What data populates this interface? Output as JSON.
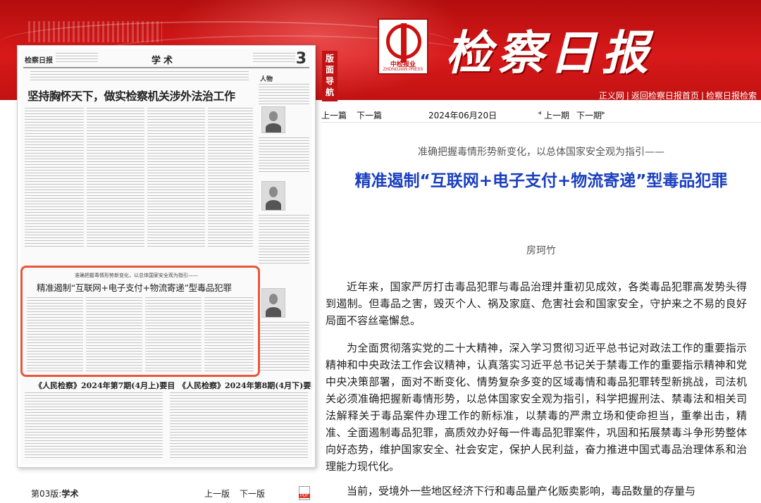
{
  "masthead": {
    "logo_name": "中检报业",
    "logo_sub": "ZHONGJIAN PRESS",
    "paper_name": "检察日报",
    "links": [
      "正义网",
      "返回检察日报首页",
      "检察日报检索"
    ]
  },
  "left_nav": {
    "label": [
      "版",
      "面",
      "导",
      "航"
    ]
  },
  "page_preview": {
    "paper_short_name": "检察日报",
    "section": "学术",
    "page_number": "3",
    "headline": "坚持胸怀天下，做实检察机关涉外法治工作",
    "highlight_kicker": "准确把握毒情形势新变化，以总体国家安全观为指引——",
    "highlight_title": "精准遏制“互联网+电子支付+物流寄递”型毒品犯罪",
    "bottom_left_title": "《人民检察》2024年第7期(4月上)要目",
    "bottom_right_title": "《人民检察》2024年第8期(4月下)要目"
  },
  "page_footer": {
    "edition_label": "第03版:",
    "edition_name": "学术",
    "prev_page": "上一版",
    "next_page": "下一版"
  },
  "article_nav": {
    "prev_article": "上一篇",
    "next_article": "下一篇",
    "date": "2024年06月20日",
    "prev_issue": "上一期",
    "next_issue": "下一期"
  },
  "article": {
    "kicker": "准确把握毒情形势新变化，以总体国家安全观为指引——",
    "title": "精准遏制“互联网+电子支付+物流寄递”型毒品犯罪",
    "author": "房珂竹",
    "paragraphs": [
      "近年来，国家严厉打击毒品犯罪与毒品治理并重初见成效，各类毒品犯罪高发势头得到遏制。但毒品之害，毁灭个人、祸及家庭、危害社会和国家安全，守护来之不易的良好局面不容丝毫懈怠。",
      "为全面贯彻落实党的二十大精神，深入学习贯彻习近平总书记对政法工作的重要指示精神和中央政法工作会议精神，认真落实习近平总书记关于禁毒工作的重要指示精神和党中央决策部署，面对不断变化、情势复杂多变的区域毒情和毒品犯罪转型新挑战，司法机关必须准确把握新毒情形势，以总体国家安全观为指引，科学把握刑法、禁毒法和相关司法解释关于毒品案件办理工作的新标准，以禁毒的严肃立场和使命担当，重拳出击，精准、全面遏制毒品犯罪，高质效办好每一件毒品犯罪案件，巩固和拓展禁毒斗争形势整体向好态势，维护国家安全、社会安定，保护人民利益，奋力推进中国式毒品治理体系和治理能力现代化。",
      "当前，受境外一些地区经济下行和毒品量产化贩卖影响，毒品数量的存量与"
    ]
  },
  "colors": {
    "banner_red": "#d8191a",
    "title_blue": "#1a3fbf",
    "highlight_orange": "#e8573c"
  }
}
